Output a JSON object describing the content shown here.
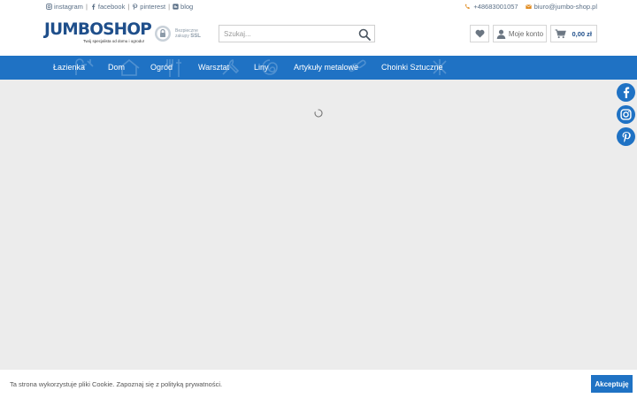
{
  "topbar": {
    "social": [
      {
        "label": "instagram",
        "icon": "instagram-icon"
      },
      {
        "label": "facebook",
        "icon": "facebook-icon"
      },
      {
        "label": "pinterest",
        "icon": "pinterest-icon"
      },
      {
        "label": "blog",
        "icon": "blog-icon"
      }
    ],
    "separator": "|",
    "phone": "+48683001057",
    "email": "biuro@jumbo-shop.pl"
  },
  "header": {
    "logo_part1": "JUMBO",
    "logo_part2": "SHOP",
    "logo_tagline": "Twój specjalista od domu i ogrodu!",
    "ssl_line1": "Bezpieczne",
    "ssl_line2": "zakupy",
    "ssl_line3": "SSL",
    "search_placeholder": "Szukaj...",
    "account_label": "Moje konto",
    "cart_total": "0,00 zł"
  },
  "nav": {
    "items": [
      "Łazienka",
      "Dom",
      "Ogród",
      "Warsztat",
      "Liny",
      "Artykuły metalowe",
      "Choinki Sztuczne"
    ]
  },
  "cookie": {
    "text": "Ta strona wykorzystuje pliki Cookie. Zapoznaj się z polityką prywatności.",
    "accept": "Akceptuję"
  },
  "colors": {
    "brand_blue": "#1f72c4",
    "logo_blue": "#1f4f8b",
    "accent_orange": "#e08a1e",
    "background": "#ececec"
  }
}
